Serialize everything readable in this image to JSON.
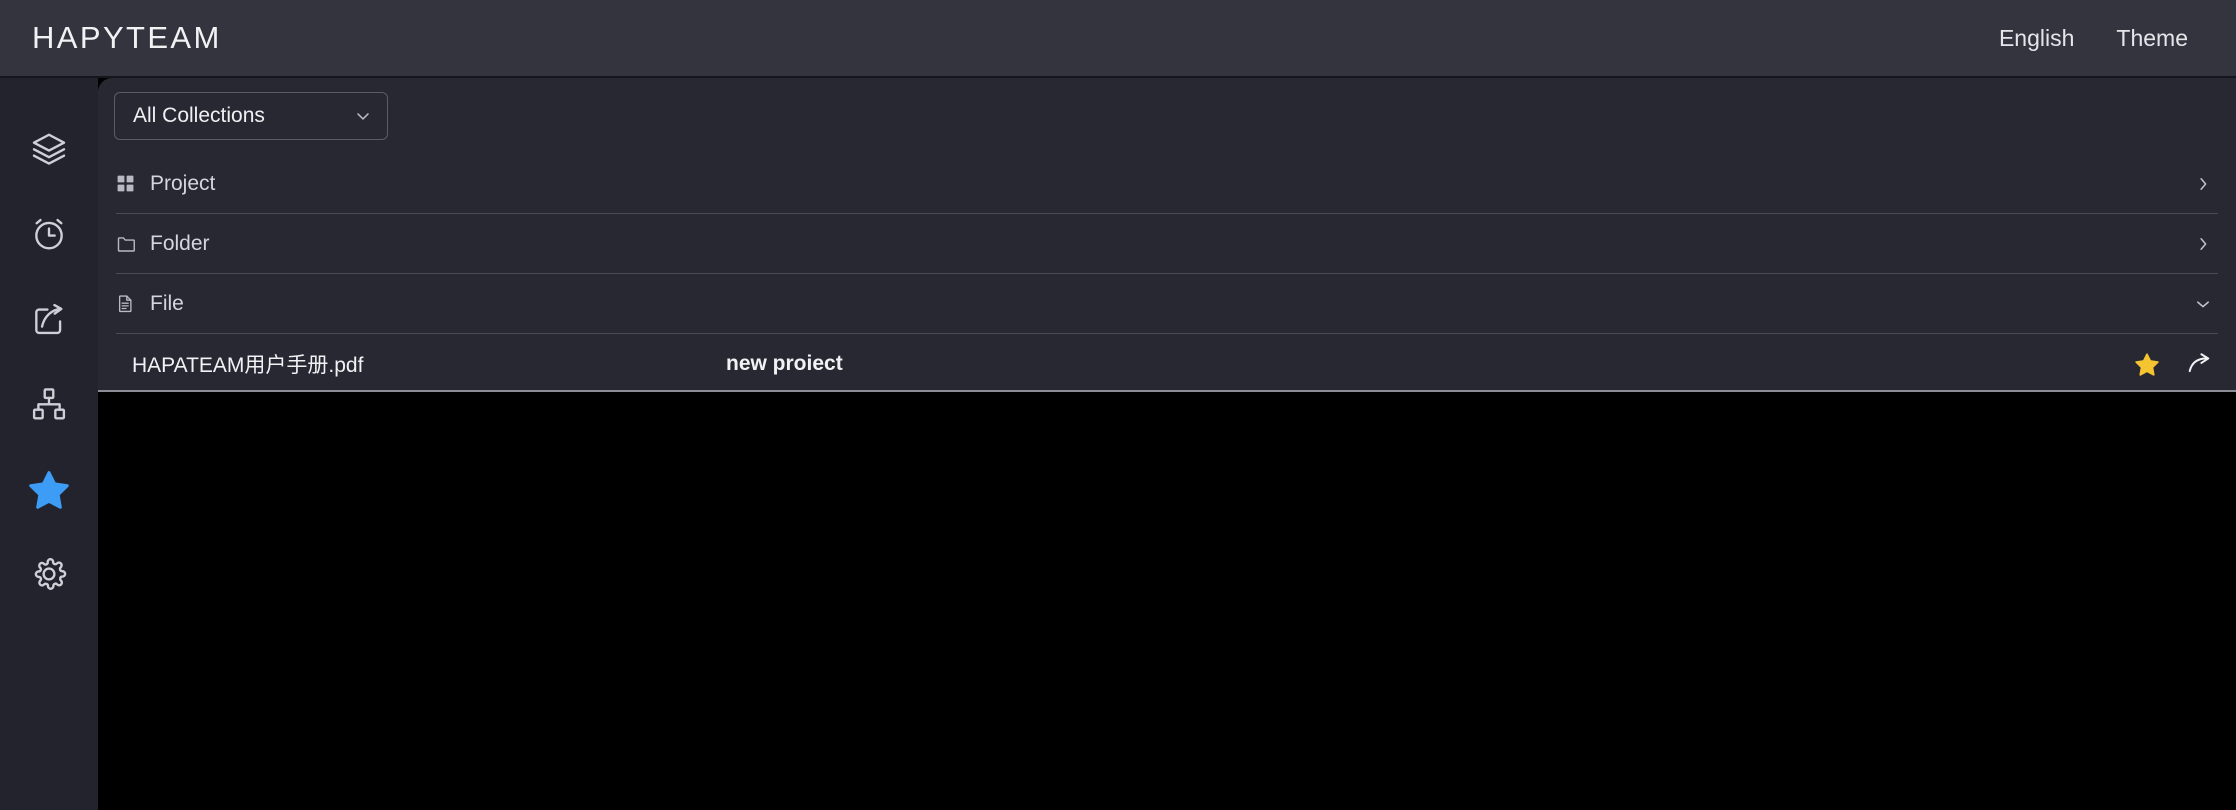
{
  "header": {
    "brand": "HAPYTEAM",
    "links": [
      {
        "label": "English",
        "name": "language-link"
      },
      {
        "label": "Theme",
        "name": "theme-link"
      }
    ]
  },
  "sidebar": {
    "items": [
      {
        "icon": "layers-icon",
        "active": false
      },
      {
        "icon": "alarm-clock-icon",
        "active": false
      },
      {
        "icon": "share-export-icon",
        "active": false
      },
      {
        "icon": "sitemap-icon",
        "active": false
      },
      {
        "icon": "star-icon",
        "active": true
      },
      {
        "icon": "settings-gear-icon",
        "active": false
      }
    ],
    "active_color": "#3d9cf5"
  },
  "toolbar": {
    "collection_select": {
      "value": "All Collections",
      "icon": "chevron-down-icon"
    }
  },
  "sections": [
    {
      "label": "Project",
      "icon": "grid-apps-icon",
      "chevron": "chevron-right-icon",
      "expanded": false
    },
    {
      "label": "Folder",
      "icon": "folder-icon",
      "chevron": "chevron-right-icon",
      "expanded": false
    },
    {
      "label": "File",
      "icon": "document-icon",
      "chevron": "chevron-down-icon",
      "expanded": true
    }
  ],
  "files": [
    {
      "name": "HAPATEAM用户手册.pdf",
      "project": "new proiect",
      "favorite": true,
      "favorite_color": "#f5c531",
      "actions": [
        {
          "icon": "star-filled-icon"
        },
        {
          "icon": "share-arrow-icon"
        }
      ]
    }
  ],
  "colors": {
    "header_bg": "#34343f",
    "sidebar_bg": "#23232e",
    "panel_bg": "#282833",
    "page_bg": "#000000",
    "divider": "#4a4a56",
    "accent_blue": "#3d9cf5",
    "star_gold": "#f5c531"
  }
}
